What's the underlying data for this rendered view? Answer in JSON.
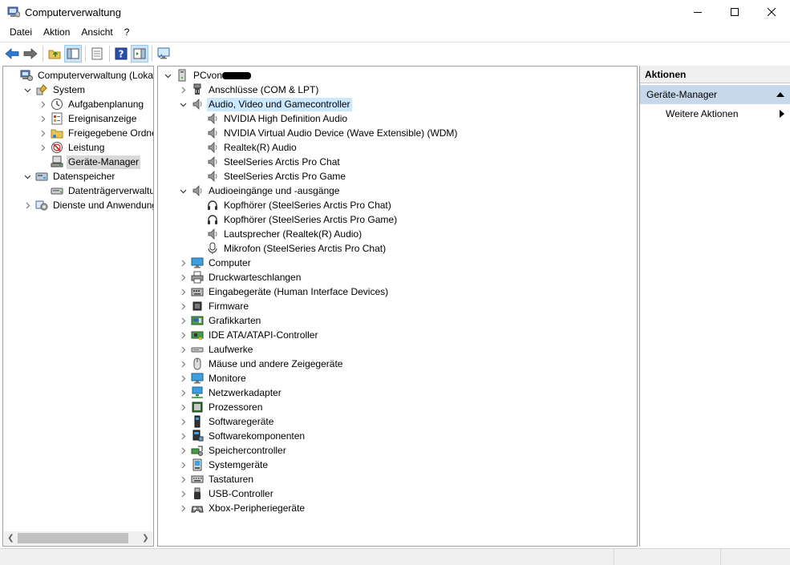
{
  "window": {
    "title": "Computerverwaltung"
  },
  "menu": [
    "Datei",
    "Aktion",
    "Ansicht",
    "?"
  ],
  "left_tree": [
    {
      "label": "Computerverwaltung (Lokal)",
      "level": 0,
      "expander": "none",
      "icon": "computer-management-icon"
    },
    {
      "label": "System",
      "level": 1,
      "expander": "expanded",
      "icon": "system-tools-icon"
    },
    {
      "label": "Aufgabenplanung",
      "level": 2,
      "expander": "collapsed",
      "icon": "task-scheduler-icon"
    },
    {
      "label": "Ereignisanzeige",
      "level": 2,
      "expander": "collapsed",
      "icon": "event-viewer-icon"
    },
    {
      "label": "Freigegebene Ordner",
      "level": 2,
      "expander": "collapsed",
      "icon": "shared-folders-icon"
    },
    {
      "label": "Leistung",
      "level": 2,
      "expander": "collapsed",
      "icon": "performance-icon"
    },
    {
      "label": "Geräte-Manager",
      "level": 2,
      "expander": "none",
      "icon": "device-manager-icon",
      "selected": true
    },
    {
      "label": "Datenspeicher",
      "level": 1,
      "expander": "expanded",
      "icon": "storage-icon"
    },
    {
      "label": "Datenträgerverwaltung",
      "level": 2,
      "expander": "none",
      "icon": "disk-management-icon"
    },
    {
      "label": "Dienste und Anwendungen",
      "level": 1,
      "expander": "collapsed",
      "icon": "services-icon"
    }
  ],
  "device_tree": [
    {
      "label": "PCvon",
      "level": 0,
      "expander": "expanded",
      "icon": "pc-icon",
      "redacted": true
    },
    {
      "label": "Anschlüsse (COM & LPT)",
      "level": 1,
      "expander": "collapsed",
      "icon": "port-icon"
    },
    {
      "label": "Audio, Video und Gamecontroller",
      "level": 1,
      "expander": "expanded",
      "icon": "speaker-icon",
      "selected": true
    },
    {
      "label": "NVIDIA High Definition Audio",
      "level": 2,
      "expander": "none",
      "icon": "speaker-icon"
    },
    {
      "label": "NVIDIA Virtual Audio Device (Wave Extensible) (WDM)",
      "level": 2,
      "expander": "none",
      "icon": "speaker-icon"
    },
    {
      "label": "Realtek(R) Audio",
      "level": 2,
      "expander": "none",
      "icon": "speaker-icon"
    },
    {
      "label": "SteelSeries Arctis Pro Chat",
      "level": 2,
      "expander": "none",
      "icon": "speaker-icon"
    },
    {
      "label": "SteelSeries Arctis Pro Game",
      "level": 2,
      "expander": "none",
      "icon": "speaker-icon"
    },
    {
      "label": "Audioeingänge und -ausgänge",
      "level": 1,
      "expander": "expanded",
      "icon": "speaker-icon"
    },
    {
      "label": "Kopfhörer (SteelSeries Arctis Pro Chat)",
      "level": 2,
      "expander": "none",
      "icon": "headphones-icon"
    },
    {
      "label": "Kopfhörer (SteelSeries Arctis Pro Game)",
      "level": 2,
      "expander": "none",
      "icon": "headphones-icon"
    },
    {
      "label": "Lautsprecher (Realtek(R) Audio)",
      "level": 2,
      "expander": "none",
      "icon": "speaker-icon"
    },
    {
      "label": "Mikrofon (SteelSeries Arctis Pro Chat)",
      "level": 2,
      "expander": "none",
      "icon": "microphone-icon"
    },
    {
      "label": "Computer",
      "level": 1,
      "expander": "collapsed",
      "icon": "monitor-icon"
    },
    {
      "label": "Druckwarteschlangen",
      "level": 1,
      "expander": "collapsed",
      "icon": "printer-icon"
    },
    {
      "label": "Eingabegeräte (Human Interface Devices)",
      "level": 1,
      "expander": "collapsed",
      "icon": "hid-icon"
    },
    {
      "label": "Firmware",
      "level": 1,
      "expander": "collapsed",
      "icon": "chip-icon"
    },
    {
      "label": "Grafikkarten",
      "level": 1,
      "expander": "collapsed",
      "icon": "display-adapter-icon"
    },
    {
      "label": "IDE ATA/ATAPI-Controller",
      "level": 1,
      "expander": "collapsed",
      "icon": "controller-icon"
    },
    {
      "label": "Laufwerke",
      "level": 1,
      "expander": "collapsed",
      "icon": "drive-icon"
    },
    {
      "label": "Mäuse und andere Zeigegeräte",
      "level": 1,
      "expander": "collapsed",
      "icon": "mouse-icon"
    },
    {
      "label": "Monitore",
      "level": 1,
      "expander": "collapsed",
      "icon": "monitor-icon"
    },
    {
      "label": "Netzwerkadapter",
      "level": 1,
      "expander": "collapsed",
      "icon": "network-icon"
    },
    {
      "label": "Prozessoren",
      "level": 1,
      "expander": "collapsed",
      "icon": "processor-icon"
    },
    {
      "label": "Softwaregeräte",
      "level": 1,
      "expander": "collapsed",
      "icon": "software-device-icon"
    },
    {
      "label": "Softwarekomponenten",
      "level": 1,
      "expander": "collapsed",
      "icon": "software-component-icon"
    },
    {
      "label": "Speichercontroller",
      "level": 1,
      "expander": "collapsed",
      "icon": "storage-controller-icon"
    },
    {
      "label": "Systemgeräte",
      "level": 1,
      "expander": "collapsed",
      "icon": "system-device-icon"
    },
    {
      "label": "Tastaturen",
      "level": 1,
      "expander": "collapsed",
      "icon": "keyboard-icon"
    },
    {
      "label": "USB-Controller",
      "level": 1,
      "expander": "collapsed",
      "icon": "usb-icon"
    },
    {
      "label": "Xbox-Peripheriegeräte",
      "level": 1,
      "expander": "collapsed",
      "icon": "gamepad-icon"
    }
  ],
  "actions": {
    "header": "Aktionen",
    "section": "Geräte-Manager",
    "item": "Weitere Aktionen"
  },
  "colors": {
    "selection": "#cce8ff",
    "actions_section": "#c6d8ea"
  }
}
